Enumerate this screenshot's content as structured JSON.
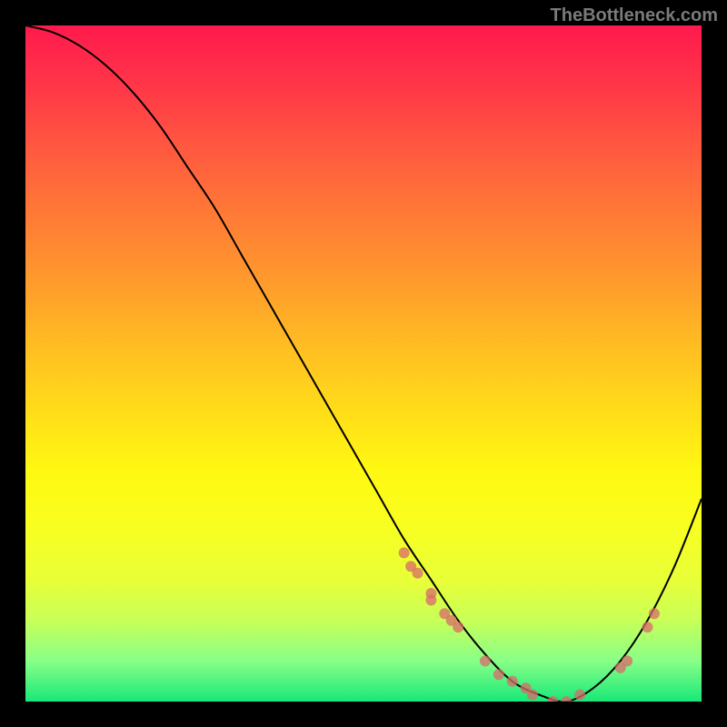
{
  "watermark": "TheBottleneck.com",
  "chart_data": {
    "type": "line",
    "title": "",
    "xlabel": "",
    "ylabel": "",
    "xlim": [
      0,
      100
    ],
    "ylim": [
      0,
      100
    ],
    "grid": false,
    "legend": false,
    "background_gradient": {
      "top": "#ff1a4d",
      "bottom": "#18e878"
    },
    "series": [
      {
        "name": "bottleneck-curve",
        "x": [
          0,
          4,
          8,
          12,
          16,
          20,
          24,
          28,
          32,
          36,
          40,
          44,
          48,
          52,
          56,
          60,
          64,
          68,
          72,
          76,
          80,
          84,
          88,
          92,
          96,
          100
        ],
        "y": [
          100,
          99,
          97,
          94,
          90,
          85,
          79,
          73,
          66,
          59,
          52,
          45,
          38,
          31,
          24,
          18,
          12,
          7,
          3,
          1,
          0,
          2,
          6,
          12,
          20,
          30
        ]
      }
    ],
    "scatter_points": {
      "name": "marked-points",
      "x": [
        56,
        57,
        58,
        60,
        60,
        62,
        63,
        64,
        68,
        70,
        72,
        74,
        75,
        78,
        80,
        82,
        88,
        89,
        92,
        93
      ],
      "y": [
        22,
        20,
        19,
        16,
        15,
        13,
        12,
        11,
        6,
        4,
        3,
        2,
        1,
        0,
        0,
        1,
        5,
        6,
        11,
        13
      ]
    }
  }
}
